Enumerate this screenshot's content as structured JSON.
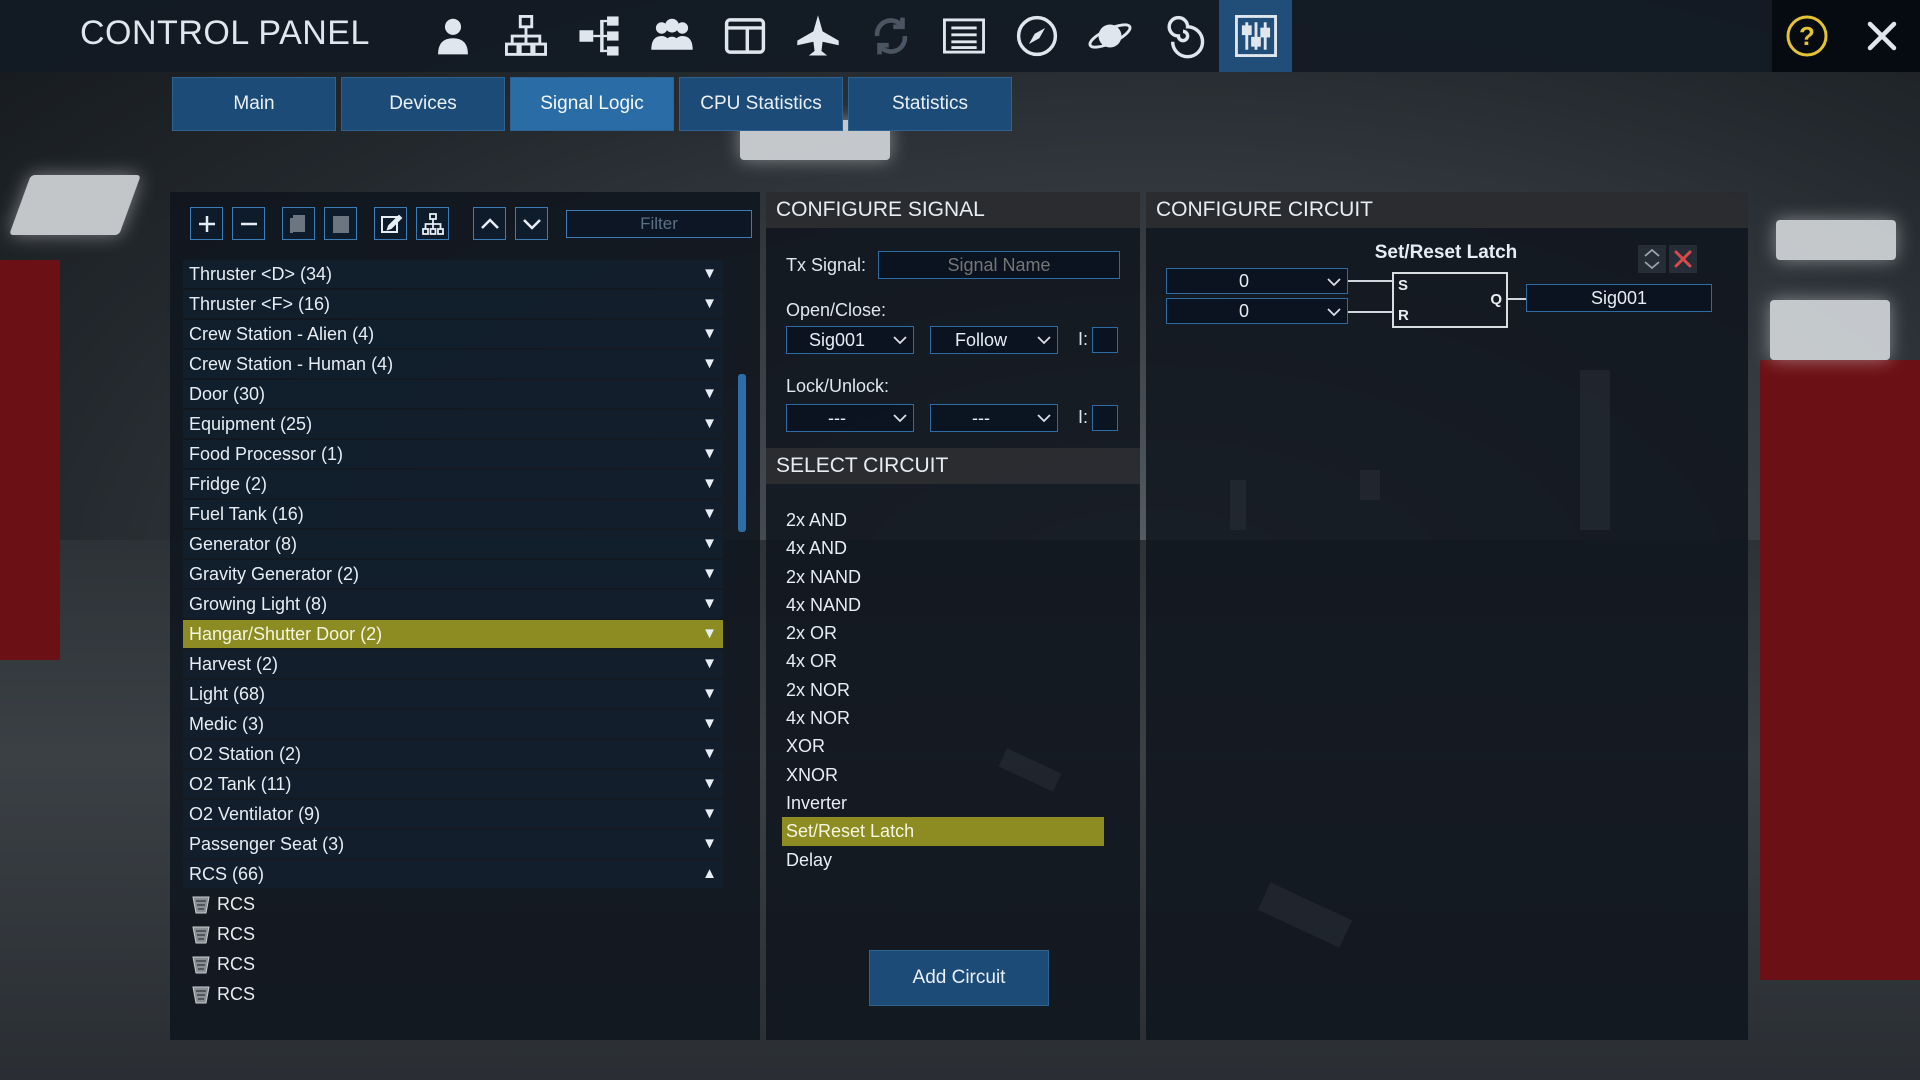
{
  "app": {
    "title": "CONTROL PANEL"
  },
  "toolbar_icons": [
    {
      "name": "crew-icon"
    },
    {
      "name": "network-icon"
    },
    {
      "name": "hierarchy-icon"
    },
    {
      "name": "group-icon"
    },
    {
      "name": "window-icon"
    },
    {
      "name": "ship-icon"
    },
    {
      "name": "transfer-icon"
    },
    {
      "name": "list-icon"
    },
    {
      "name": "compass-icon"
    },
    {
      "name": "planet-icon"
    },
    {
      "name": "galaxy-icon"
    },
    {
      "name": "sliders-icon"
    }
  ],
  "tabs": [
    {
      "label": "Main"
    },
    {
      "label": "Devices"
    },
    {
      "label": "Signal Logic"
    },
    {
      "label": "CPU Statistics"
    },
    {
      "label": "Statistics"
    }
  ],
  "active_tab": "Signal Logic",
  "left": {
    "filter_placeholder": "Filter",
    "devices": [
      {
        "label": "Thruster <D> (34)",
        "expanded": false
      },
      {
        "label": "Thruster <F> (16)",
        "expanded": false
      },
      {
        "label": "Crew Station - Alien (4)",
        "expanded": false
      },
      {
        "label": "Crew Station - Human (4)",
        "expanded": false
      },
      {
        "label": "Door (30)",
        "expanded": false
      },
      {
        "label": "Equipment (25)",
        "expanded": false
      },
      {
        "label": "Food Processor (1)",
        "expanded": false
      },
      {
        "label": "Fridge (2)",
        "expanded": false
      },
      {
        "label": "Fuel Tank (16)",
        "expanded": false
      },
      {
        "label": "Generator (8)",
        "expanded": false
      },
      {
        "label": "Gravity Generator (2)",
        "expanded": false
      },
      {
        "label": "Growing Light (8)",
        "expanded": false
      },
      {
        "label": "Hangar/Shutter Door (2)",
        "expanded": false,
        "selected": true
      },
      {
        "label": "Harvest (2)",
        "expanded": false
      },
      {
        "label": "Light (68)",
        "expanded": false
      },
      {
        "label": "Medic (3)",
        "expanded": false
      },
      {
        "label": "O2 Station (2)",
        "expanded": false
      },
      {
        "label": "O2 Tank (11)",
        "expanded": false
      },
      {
        "label": "O2 Ventilator (9)",
        "expanded": false
      },
      {
        "label": "Passenger Seat (3)",
        "expanded": false
      },
      {
        "label": "RCS (66)",
        "expanded": true
      }
    ],
    "sub_items": [
      {
        "label": "RCS"
      },
      {
        "label": "RCS"
      },
      {
        "label": "RCS"
      },
      {
        "label": "RCS"
      }
    ],
    "arrow_down": "▼",
    "arrow_up": "▲"
  },
  "configure_signal": {
    "header": "CONFIGURE SIGNAL",
    "tx_label": "Tx Signal:",
    "tx_placeholder": "Signal Name",
    "open_close_label": "Open/Close:",
    "open_close_signal": "Sig001",
    "open_close_mode": "Follow",
    "inv_label": "I:",
    "lock_label": "Lock/Unlock:",
    "lock_signal": "---",
    "lock_mode": "---"
  },
  "select_circuit": {
    "header": "SELECT CIRCUIT",
    "items": [
      "2x AND",
      "4x AND",
      "2x NAND",
      "4x NAND",
      "2x OR",
      "4x OR",
      "2x NOR",
      "4x NOR",
      "XOR",
      "XNOR",
      "Inverter",
      "Set/Reset Latch",
      "Delay"
    ],
    "selected": "Set/Reset Latch",
    "add_button": "Add Circuit"
  },
  "configure_circuit": {
    "header": "CONFIGURE CIRCUIT",
    "circuit_title": "Set/Reset Latch",
    "input_s": "0",
    "input_r": "0",
    "pin_s": "S",
    "pin_r": "R",
    "pin_q": "Q",
    "output": "Sig001"
  },
  "colors": {
    "accent": "#2a6ca6",
    "selected": "#8c8c22",
    "panel": "#10161e"
  }
}
